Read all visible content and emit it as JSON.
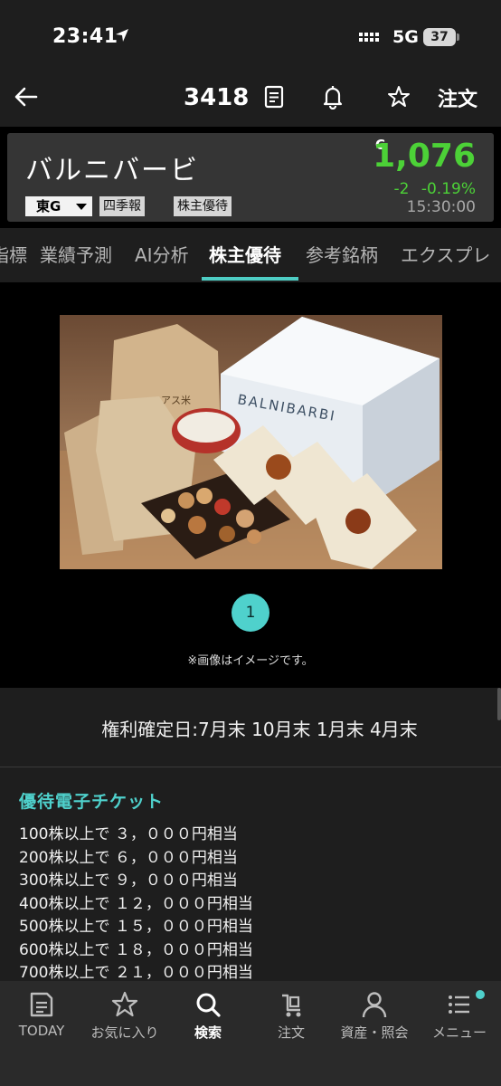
{
  "status": {
    "time": "23:41",
    "network": "5G",
    "battery": "37"
  },
  "header": {
    "stock_code": "3418",
    "order_label": "注文"
  },
  "stock": {
    "name": "バルニバービ",
    "market": "東G",
    "tags": [
      "四季報",
      "株主優待"
    ],
    "price_flag": "C",
    "price": "1,076",
    "change": "-2",
    "change_pct": "-0.19%",
    "time": "15:30:00",
    "price_color": "#4cd137"
  },
  "tabs": [
    "指標",
    "業績予測",
    "AI分析",
    "株主優待",
    "参考銘柄",
    "エクスプレ"
  ],
  "active_tab": "株主優待",
  "gallery": {
    "page": "1",
    "note": "※画像はイメージです。",
    "image_texts": {
      "box_brand": "BALNIBARBI",
      "rice_bag": "アス米"
    }
  },
  "benefits": {
    "record_date": "権利確定日:7月末 10月末 1月末 4月末",
    "title": "優待電子チケット",
    "tiers": [
      "100株以上で ３，０００円相当",
      "200株以上で ６，０００円相当",
      "300株以上で ９，０００円相当",
      "400株以上で １２，０００円相当",
      "500株以上で １５，０００円相当",
      "600株以上で １８，０００円相当",
      "700株以上で ２１，０００円相当"
    ]
  },
  "nav": {
    "items": [
      {
        "label": "TODAY",
        "icon": "news-icon"
      },
      {
        "label": "お気に入り",
        "icon": "star-icon"
      },
      {
        "label": "検索",
        "icon": "search-icon"
      },
      {
        "label": "注文",
        "icon": "cart-icon"
      },
      {
        "label": "資産・照会",
        "icon": "person-icon"
      },
      {
        "label": "メニュー",
        "icon": "menu-icon"
      }
    ],
    "active": "検索",
    "accent": "#4fd1cc"
  }
}
